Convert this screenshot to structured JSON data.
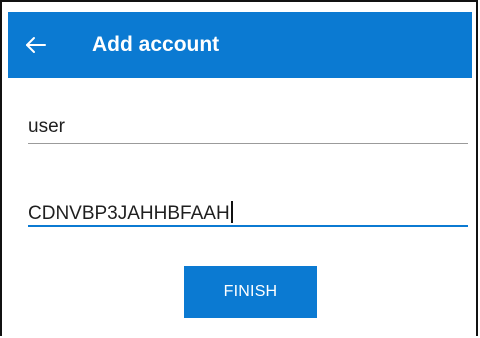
{
  "colors": {
    "primary": "#0b7ad2",
    "text": "#1f1f1f",
    "underline_inactive": "#9b9b9b",
    "on_primary": "#ffffff"
  },
  "header": {
    "back_icon": "back-arrow-icon",
    "title": "Add account"
  },
  "form": {
    "username": {
      "value": "user"
    },
    "secret_key": {
      "value": "CDNVBP3JAHHBFAAH"
    }
  },
  "actions": {
    "finish_label": "FINISH"
  }
}
